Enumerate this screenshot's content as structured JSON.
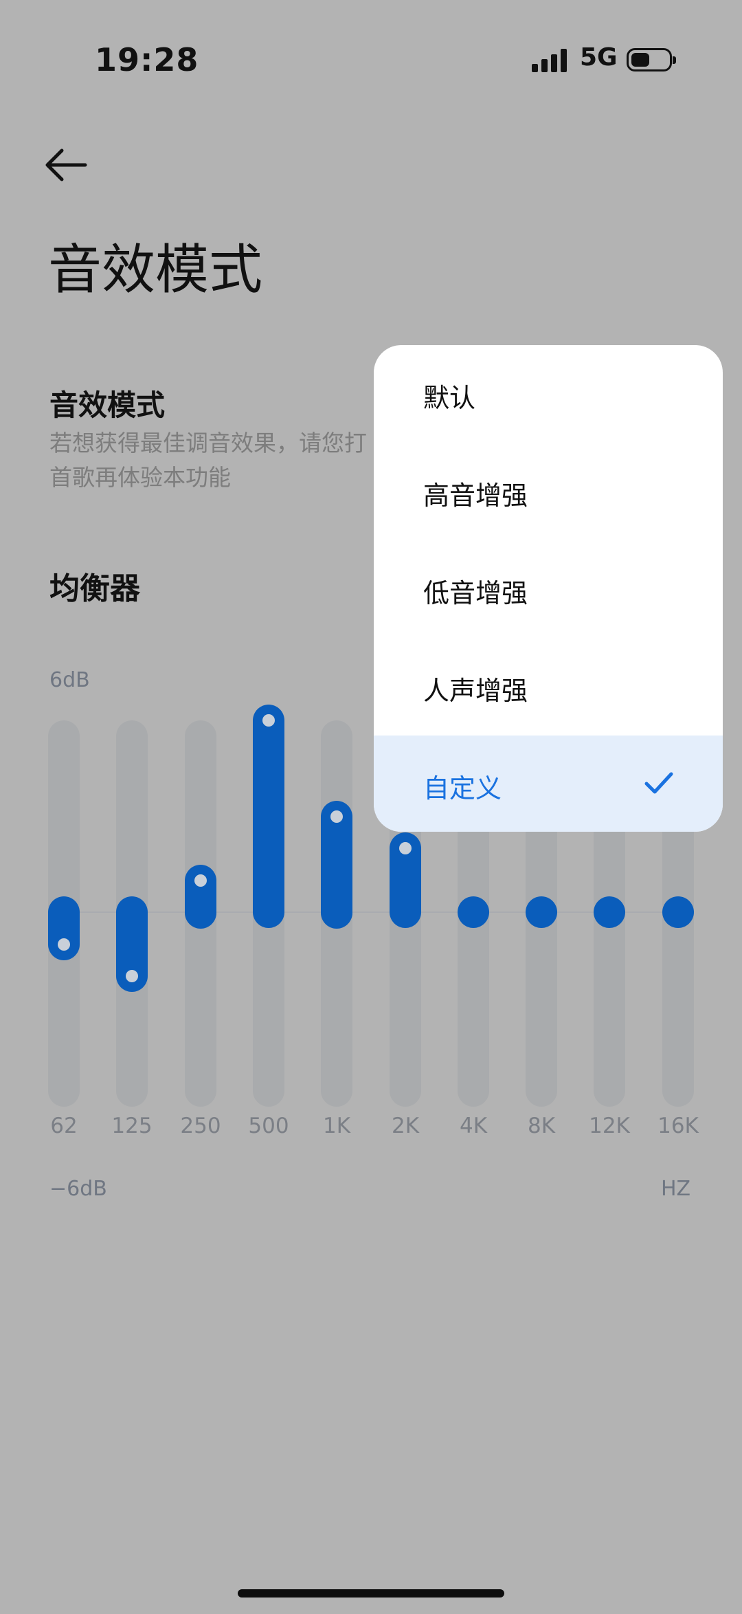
{
  "status_bar": {
    "time": "19:28",
    "network": "5G"
  },
  "page": {
    "title": "音效模式"
  },
  "sound_mode": {
    "title": "音效模式",
    "description_line1": "若想获得最佳调音效果，请您打",
    "description_line2": "首歌再体验本功能"
  },
  "equalizer": {
    "title": "均衡器",
    "max_label": "6dB",
    "min_label": "−6dB",
    "unit_label": "HZ",
    "bands": [
      {
        "freq": "62",
        "value": -1.0
      },
      {
        "freq": "125",
        "value": -2.0
      },
      {
        "freq": "250",
        "value": 1.0
      },
      {
        "freq": "500",
        "value": 6.0
      },
      {
        "freq": "1K",
        "value": 3.0
      },
      {
        "freq": "2K",
        "value": 2.0
      },
      {
        "freq": "4K",
        "value": 0.0
      },
      {
        "freq": "8K",
        "value": 0.0
      },
      {
        "freq": "12K",
        "value": 0.0
      },
      {
        "freq": "16K",
        "value": 0.0
      }
    ]
  },
  "dropdown": {
    "items": [
      {
        "label": "默认"
      },
      {
        "label": "高音增强"
      },
      {
        "label": "低音增强"
      },
      {
        "label": "人声增强"
      },
      {
        "label": "自定义",
        "selected": true
      }
    ]
  },
  "colors": {
    "accent": "#0a5dbb",
    "selected_text": "#1a72e0",
    "selected_bg": "#e4eefb"
  }
}
